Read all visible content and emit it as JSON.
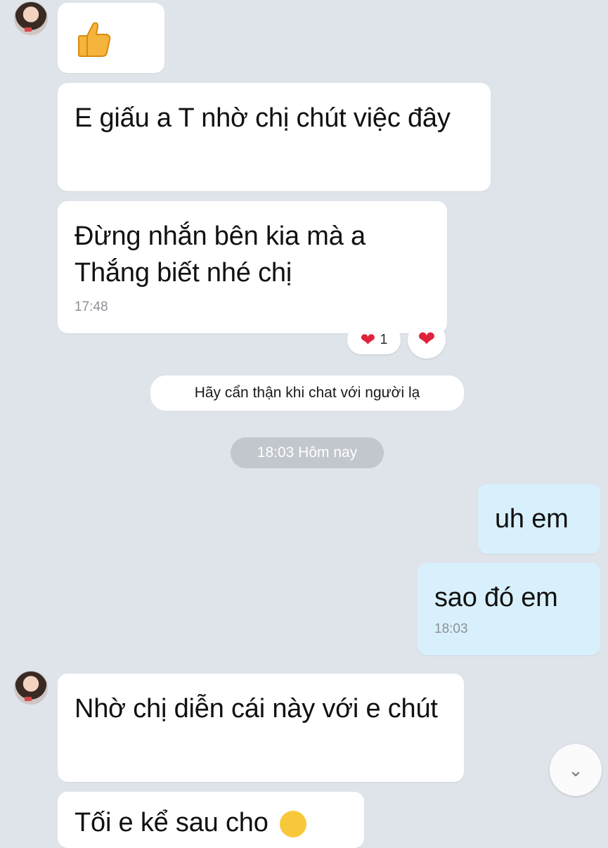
{
  "messages": [
    {
      "sender": "contact",
      "type": "sticker",
      "icon": "thumbs-up-icon"
    },
    {
      "sender": "contact",
      "text": "E giấu a T nhờ chị chút việc đây"
    },
    {
      "sender": "contact",
      "text": "Đừng nhắn bên kia mà a Thắng biết nhé chị",
      "time": "17:48",
      "reactions": {
        "count": "1",
        "icon": "heart-icon"
      }
    },
    {
      "sender": "me",
      "text": "uh em"
    },
    {
      "sender": "me",
      "text": "sao đó em",
      "time": "18:03"
    },
    {
      "sender": "contact",
      "text": "Nhờ chị diễn cái này với e chút"
    },
    {
      "sender": "contact",
      "text": "Tối e kể sau cho"
    }
  ],
  "system_notice": "Hãy cẩn thận khi chat với người lạ",
  "date_separator": "18:03 Hôm nay",
  "reaction_count": "1",
  "colors": {
    "background": "#dfe3ea",
    "incoming_bubble": "#ffffff",
    "outgoing_bubble": "#d8f0fb",
    "heart": "#e0223b",
    "separator_pill": "#c2c6cd"
  },
  "icons": {
    "scroll_down": "chevrons-down-icon",
    "sticker": "thumbs-up-icon",
    "partial_emoji": "slightly-smiling-face-icon"
  }
}
